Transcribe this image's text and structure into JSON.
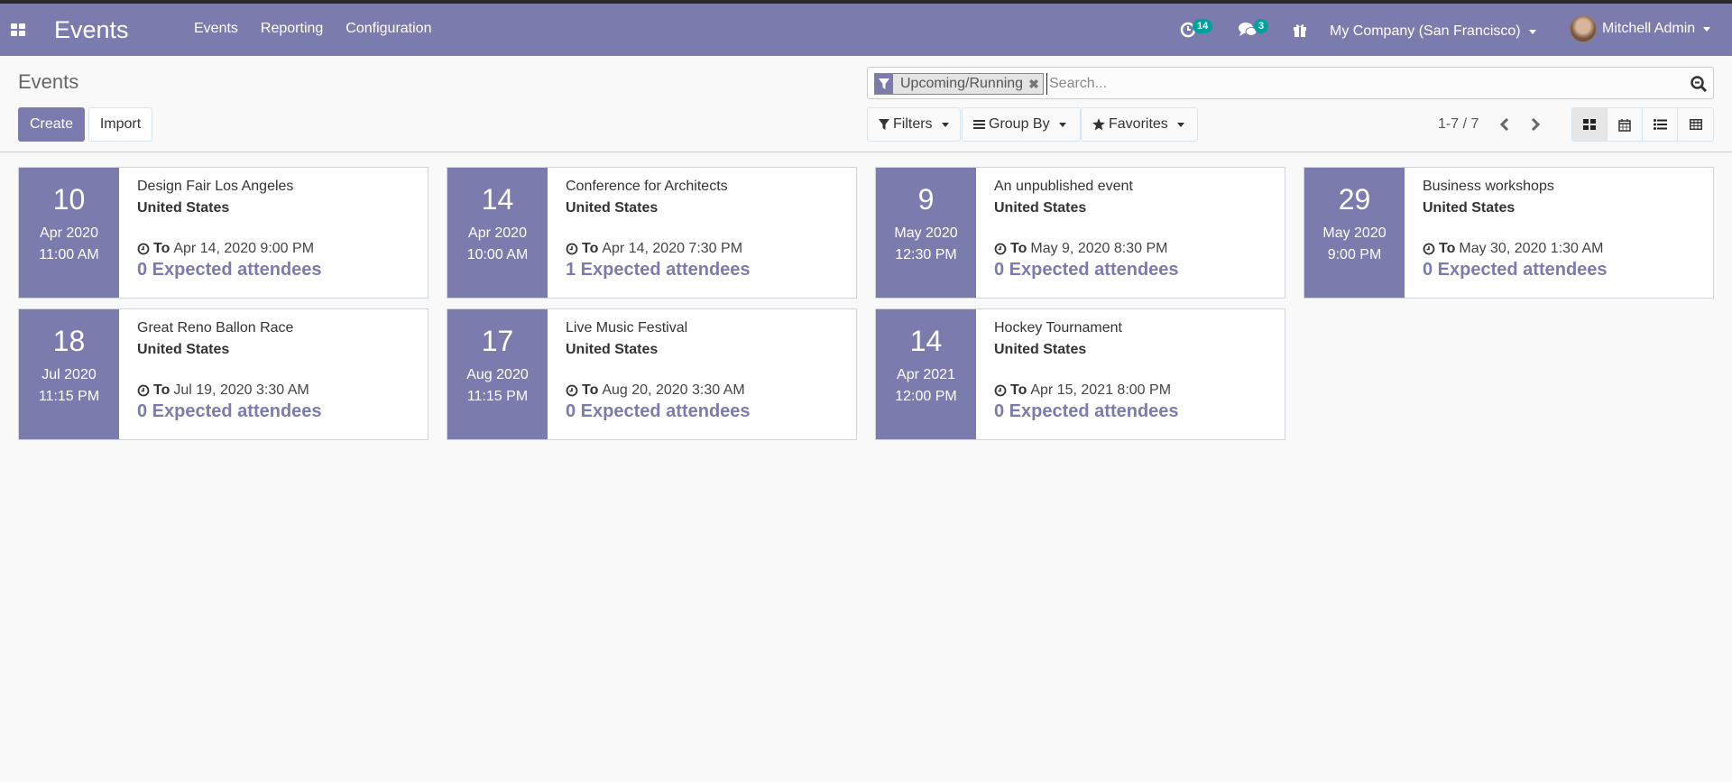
{
  "navbar": {
    "app_title": "Events",
    "menu": [
      "Events",
      "Reporting",
      "Configuration"
    ],
    "activity_count": "14",
    "message_count": "3",
    "company": "My Company (San Francisco)",
    "user": "Mitchell Admin",
    "brand_color": "#7c7bad"
  },
  "control_panel": {
    "breadcrumb": "Events",
    "create_label": "Create",
    "import_label": "Import",
    "search": {
      "facet_label": "Upcoming/Running",
      "placeholder": "Search...",
      "value": ""
    },
    "filters_label": "Filters",
    "groupby_label": "Group By",
    "favorites_label": "Favorites",
    "pager": "1-7 / 7",
    "views": [
      "kanban",
      "calendar",
      "list",
      "pivot"
    ],
    "active_view": "kanban"
  },
  "events": [
    {
      "day": "10",
      "month": "Apr 2020",
      "time": "11:00 AM",
      "name": "Design Fair Los Angeles",
      "country": "United States",
      "to_label": "To",
      "end": "Apr 14, 2020 9:00 PM",
      "attendees": "0 Expected attendees"
    },
    {
      "day": "14",
      "month": "Apr 2020",
      "time": "10:00 AM",
      "name": "Conference for Architects",
      "country": "United States",
      "to_label": "To",
      "end": "Apr 14, 2020 7:30 PM",
      "attendees": "1 Expected attendees"
    },
    {
      "day": "9",
      "month": "May 2020",
      "time": "12:30 PM",
      "name": "An unpublished event",
      "country": "United States",
      "to_label": "To",
      "end": "May 9, 2020 8:30 PM",
      "attendees": "0 Expected attendees"
    },
    {
      "day": "29",
      "month": "May 2020",
      "time": "9:00 PM",
      "name": "Business workshops",
      "country": "United States",
      "to_label": "To",
      "end": "May 30, 2020 1:30 AM",
      "attendees": "0 Expected attendees"
    },
    {
      "day": "18",
      "month": "Jul 2020",
      "time": "11:15 PM",
      "name": "Great Reno Ballon Race",
      "country": "United States",
      "to_label": "To",
      "end": "Jul 19, 2020 3:30 AM",
      "attendees": "0 Expected attendees"
    },
    {
      "day": "17",
      "month": "Aug 2020",
      "time": "11:15 PM",
      "name": "Live Music Festival",
      "country": "United States",
      "to_label": "To",
      "end": "Aug 20, 2020 3:30 AM",
      "attendees": "0 Expected attendees"
    },
    {
      "day": "14",
      "month": "Apr 2021",
      "time": "12:00 PM",
      "name": "Hockey Tournament",
      "country": "United States",
      "to_label": "To",
      "end": "Apr 15, 2021 8:00 PM",
      "attendees": "0 Expected attendees"
    }
  ]
}
